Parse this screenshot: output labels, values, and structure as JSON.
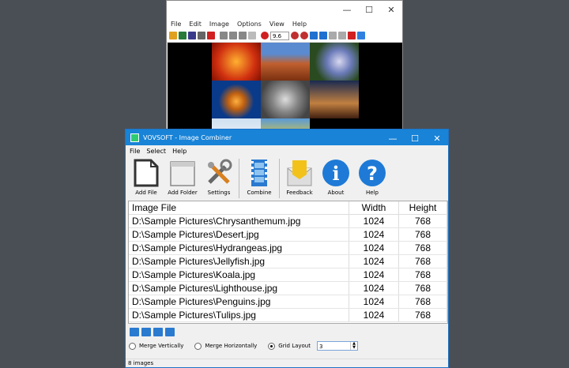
{
  "viewer": {
    "menu": [
      "File",
      "Edit",
      "Image",
      "Options",
      "View",
      "Help"
    ],
    "zoom": "9.6"
  },
  "main": {
    "title": "VOVSOFT - Image Combiner",
    "menu": [
      "File",
      "Select",
      "Help"
    ],
    "toolbar": {
      "add_file": "Add File",
      "add_folder": "Add Folder",
      "settings": "Settings",
      "combine": "Combine",
      "feedback": "Feedback",
      "about": "About",
      "help": "Help"
    },
    "table": {
      "headers": [
        "Image File",
        "Width",
        "Height"
      ],
      "rows": [
        [
          "D:\\Sample Pictures\\Chrysanthemum.jpg",
          "1024",
          "768"
        ],
        [
          "D:\\Sample Pictures\\Desert.jpg",
          "1024",
          "768"
        ],
        [
          "D:\\Sample Pictures\\Hydrangeas.jpg",
          "1024",
          "768"
        ],
        [
          "D:\\Sample Pictures\\Jellyfish.jpg",
          "1024",
          "768"
        ],
        [
          "D:\\Sample Pictures\\Koala.jpg",
          "1024",
          "768"
        ],
        [
          "D:\\Sample Pictures\\Lighthouse.jpg",
          "1024",
          "768"
        ],
        [
          "D:\\Sample Pictures\\Penguins.jpg",
          "1024",
          "768"
        ],
        [
          "D:\\Sample Pictures\\Tulips.jpg",
          "1024",
          "768"
        ]
      ]
    },
    "options": {
      "merge_vertically": "Merge Vertically",
      "merge_horizontally": "Merge Horizontally",
      "grid_layout": "Grid Layout",
      "grid_value": "3",
      "selected": "grid_layout"
    },
    "status": "8 images"
  }
}
